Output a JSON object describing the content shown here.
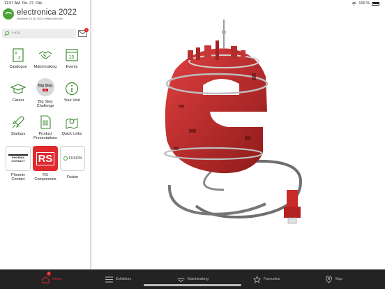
{
  "status_bar": {
    "time": "11:57 AM",
    "date": "Do. 27. Okt.",
    "battery": "100 %"
  },
  "app": {
    "logo_title": "electronica 2022",
    "logo_subtitle": "November 15-18, 2022 | Messe München",
    "brand_color": "#4aa43a",
    "accent_color": "#e0292d"
  },
  "search": {
    "placeholder": "Find"
  },
  "mail": {
    "icon": "mail-icon",
    "badge": "1"
  },
  "menu": {
    "catalogue": "Catalogue",
    "matchmaking": "Matchmaking",
    "events": "Events",
    "career": "Career",
    "big_step": "Big Step Challenge",
    "big_step_logo": "Big Step",
    "your_visit": "Your Visit",
    "startups": "Startups",
    "product_presentations": "Product Presentations",
    "quick_links": "Quick Links",
    "events_icon_text": "15"
  },
  "sponsors": {
    "phoenix_label": "Phoenix Contact",
    "phoenix_logo": "PHOENIX CONTACT",
    "rs_label": "RS Components",
    "rs_logo": "RS",
    "fusion_label": "Fusion",
    "fusion_logo": "FUSION"
  },
  "tabs": {
    "home": "Home",
    "home_badge": "1",
    "exhibitors": "Exhibitors",
    "matchmaking": "Matchmaking",
    "favourites": "Favourites",
    "map": "Map"
  }
}
